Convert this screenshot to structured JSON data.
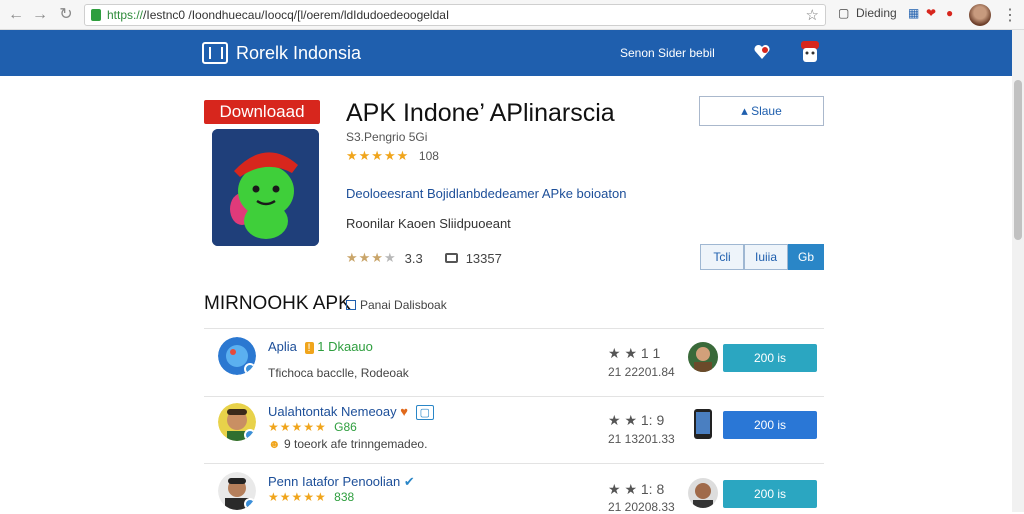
{
  "browser": {
    "url_host": "https://",
    "url": "/Iestnc0 /Ioondhuecau/Ioocq/[l/oerem/ldIdudoedeoogeldaI",
    "right_label": "Dieding"
  },
  "site": {
    "brand": "Rorelk Indonsia",
    "header_links": "Senon  Sider bebil"
  },
  "app": {
    "badge": "Downloaad",
    "title": "APK Indone’ APlinarscia",
    "subtitle": "S3.Pengrio 5Gi",
    "stars": "★★★★★",
    "rating_count": "108",
    "desc_link": "Deoloeesrant Bojidlanbdedeamer APke boioaton",
    "desc_text": "Roonilar Kaoen Sliidpuoeant",
    "meta_stars": "★★★",
    "meta_stars_empty": "★",
    "meta_score": "3.3",
    "meta_comments": "13357",
    "share_label": "Slaue",
    "segments": [
      "Tcli",
      "Iuiia",
      "Gb"
    ]
  },
  "section": {
    "title": "MIRNOOHK APK",
    "link": "Panai  Dalisboak"
  },
  "items": [
    {
      "name": "Aplia",
      "tag": "1 Dkaauo",
      "line2": "Tfichoca bacclle, Rodeoak",
      "score": "★ ★ 1 1",
      "date": "21 22201.84",
      "button": "200 is"
    },
    {
      "name": "Ualahtontak Nemeoay",
      "tag": "",
      "stars": "★★★★★",
      "count": "G86",
      "line2": "9 toeork afe trinngemadeo.",
      "score": "★ ★ 1: 9",
      "date": "21 13201.33",
      "button": "200 is"
    },
    {
      "name": "Penn Iatafor Penoolian",
      "tag": "",
      "stars": "★★★★★",
      "count": "838",
      "line2": "",
      "score": "★ ★ 1: 8",
      "date": "21 20208.33",
      "button": "200 is"
    }
  ],
  "colors": {
    "header_blue": "#1f5fae",
    "badge_red": "#d7261d",
    "link_blue": "#1d4f99",
    "btn_teal": "#2ba6c1",
    "btn_blue": "#2a77d6",
    "star_gold": "#f0a51c"
  }
}
